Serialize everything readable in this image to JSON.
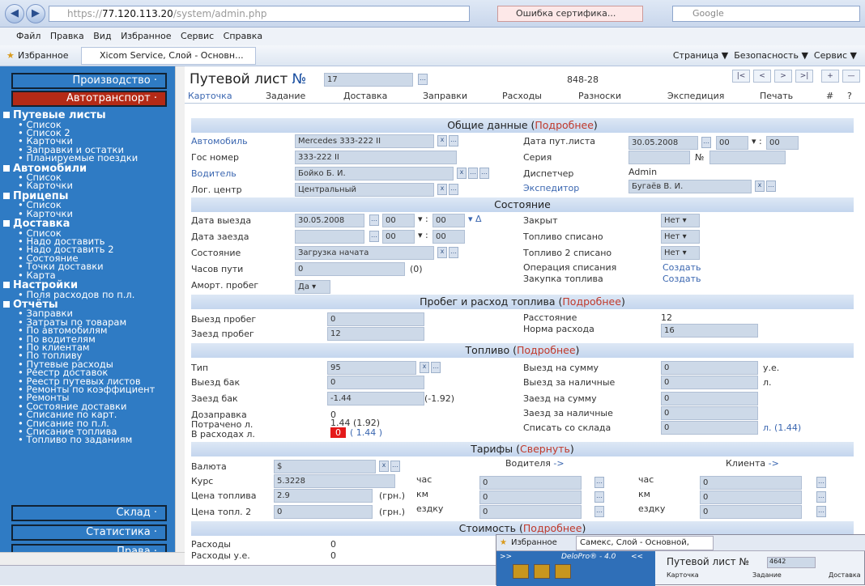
{
  "browser": {
    "url_gray": "https://",
    "url_host": "77.120.113.20",
    "url_path": "/system/admin.php",
    "cert_error": "Ошибка сертифика...",
    "search_placeholder": "Google"
  },
  "menu": [
    "Файл",
    "Правка",
    "Вид",
    "Избранное",
    "Сервис",
    "Справка"
  ],
  "favorites": {
    "label": "Избранное",
    "tab": "Xicom Service, Слой - Основн...",
    "tools": [
      "Страница ▼",
      "Безопасность ▼",
      "Сервис ▼"
    ]
  },
  "sidebar": {
    "btn_top": "Производство ·",
    "btn_active": "Автотранспорт ·",
    "sections": [
      {
        "title": "Путевые листы",
        "items": [
          "Список",
          "Список 2",
          "Карточки",
          "Заправки и остатки",
          "Планируемые поездки"
        ]
      },
      {
        "title": "Автомобили",
        "items": [
          "Список",
          "Карточки"
        ]
      },
      {
        "title": "Прицепы",
        "items": [
          "Список",
          "Карточки"
        ]
      },
      {
        "title": "Доставка",
        "items": [
          "Список",
          "Надо доставить",
          "Надо доставить 2",
          "Состояние",
          "Точки доставки",
          "Карта"
        ]
      },
      {
        "title": "Настройки",
        "items": [
          "Поля расходов по п.л."
        ]
      },
      {
        "title": "Отчёты",
        "items": [
          "Заправки",
          "Затраты по товарам",
          "По автомобилям",
          "По водителям",
          "По клиентам",
          "По топливу",
          "Путевые расходы",
          "Реестр доставок",
          "Реестр путевых листов",
          "Ремонты по коэффициент",
          "Ремонты",
          "Состояние доставки",
          "Списание по карт.",
          "Списание по п.л.",
          "Списание топлива",
          "Топливо по заданиям"
        ]
      }
    ],
    "btn_sklad": "Склад ·",
    "btn_stat": "Статистика ·",
    "btn_prava": "Права ·"
  },
  "doc": {
    "title": "Путевой лист",
    "no_label": "№",
    "number": "17",
    "code": "848-28",
    "tabs": [
      "Карточка",
      "Задание",
      "Доставка",
      "Заправки",
      "Расходы",
      "Разноски",
      "Экспедиция",
      "Печать",
      "#",
      "?"
    ],
    "nav": [
      "|<",
      "<",
      ">",
      ">|",
      "+",
      "—"
    ]
  },
  "general": {
    "header": "Общие данные",
    "more": "Подробнее",
    "avto_label": "Автомобиль",
    "avto": "Mercedes 333-222 II",
    "gos_label": "Гос номер",
    "gos": "333-222 II",
    "driver_label": "Водитель",
    "driver": "Бойко Б. И.",
    "center_label": "Лог. центр",
    "center": "Центральный",
    "date_label": "Дата пут.листа",
    "date": "30.05.2008",
    "hh": "00",
    "mm": "00",
    "seria_label": "Серия",
    "no": "№",
    "disp_label": "Диспетчер",
    "disp": "Admin",
    "exp_label": "Экспедитор",
    "exp": "Бугаёв В. И."
  },
  "state": {
    "header": "Состояние",
    "out_label": "Дата выезда",
    "out_date": "30.05.2008",
    "out_hh": "00",
    "out_mm": "00",
    "in_label": "Дата заезда",
    "in_hh": "00",
    "in_mm": "00",
    "state_label": "Состояние",
    "state": "Загрузка начата",
    "hours_label": "Часов пути",
    "hours": "0",
    "hours2": "(0)",
    "amort_label": "Аморт. пробег",
    "amort": "Да",
    "closed_label": "Закрыт",
    "closed": "Нет",
    "fuel_label": "Топливо списано",
    "fuel": "Нет",
    "fuel2_label": "Топливо 2 списано",
    "fuel2": "Нет",
    "op_label": "Операция списания",
    "op": "Создать",
    "buy_label": "Закупка топлива",
    "buy": "Создать"
  },
  "run": {
    "header": "Пробег и расход топлива",
    "more": "Подробнее",
    "out_label": "Выезд пробег",
    "out": "0",
    "in_label": "Заезд пробег",
    "in": "12",
    "dist_label": "Расстояние",
    "dist": "12",
    "norm_label": "Норма расхода",
    "norm": "16"
  },
  "fuel": {
    "header": "Топливо",
    "more": "Подробнее",
    "type_label": "Тип",
    "type": "95",
    "out_tank_label": "Выезд бак",
    "out_tank": "0",
    "in_tank_label": "Заезд бак",
    "in_tank": "-1.44",
    "in_tank2": "(-1.92)",
    "refuel_label": "Дозаправка",
    "refuel": "0",
    "spent_label": "Потрачено л.",
    "spent": "1.44 (1.92)",
    "exp_label": "В расходах л.",
    "exp_red": "0",
    "exp": "( 1.44 )",
    "sum_out_label": "Выезд на сумму",
    "sum_out": "0",
    "ue": "у.е.",
    "cash_out_label": "Выезд за наличные",
    "cash_out": "0",
    "l": "л.",
    "sum_in_label": "Заезд на сумму",
    "sum_in": "0",
    "cash_in_label": "Заезд за наличные",
    "cash_in": "0",
    "stock_label": "Списать со склада",
    "stock": "0",
    "stock2": "(1.44)"
  },
  "tariff": {
    "header": "Тарифы",
    "toggle": "Свернуть",
    "cur_label": "Валюта",
    "cur": "$",
    "rate_label": "Курс",
    "rate": "5.3228",
    "price_label": "Цена топлива",
    "price": "2.9",
    "grn": "(грн.)",
    "price2_label": "Цена топл. 2",
    "price2": "0",
    "driver_label": "Водителя",
    "client_label": "Клиента",
    "arrow": "->",
    "units": [
      "час",
      "км",
      "ездку"
    ],
    "vals": [
      "0",
      "0",
      "0"
    ]
  },
  "cost": {
    "header": "Стоимость",
    "more": "Подробнее",
    "exp_label": "Расходы",
    "exp": "0",
    "expue_label": "Расходы у.е.",
    "expue": "0"
  },
  "popup": {
    "fav": "Избранное",
    "tab": "Самекс, Слой - Основной, Поль...",
    "app": "DeloPro® - 4.0",
    "back": "<<",
    "title": "Путевой лист №",
    "num": "4642",
    "t1": "Карточка",
    "t2": "Задание",
    "t3": "Доставка"
  }
}
